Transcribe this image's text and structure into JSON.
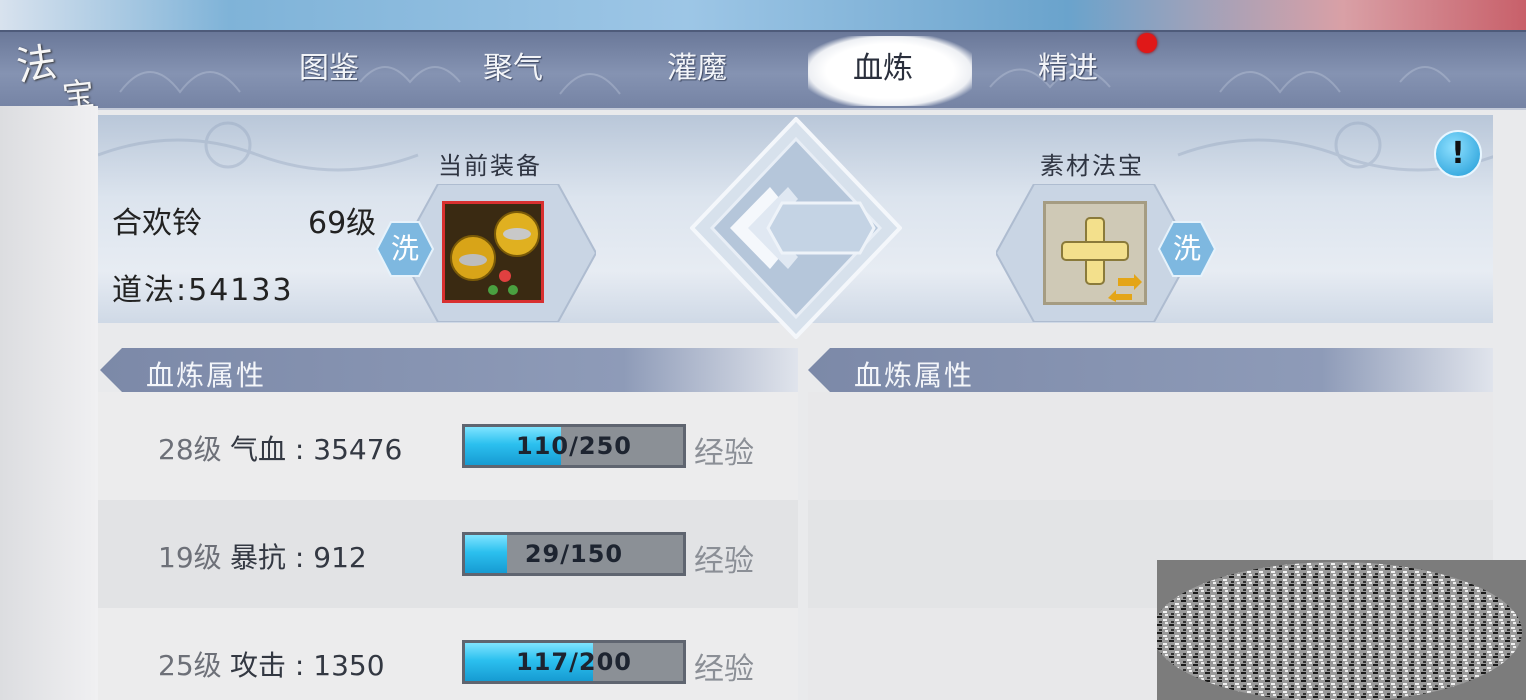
{
  "window": {
    "title_chars": [
      "法",
      "宝"
    ]
  },
  "tabs": [
    {
      "label": "图鉴",
      "active": false
    },
    {
      "label": "聚气",
      "active": false
    },
    {
      "label": "灌魔",
      "active": false
    },
    {
      "label": "血炼",
      "active": true
    },
    {
      "label": "精进",
      "active": false,
      "has_notification": true
    }
  ],
  "current_equipment": {
    "section_label": "当前装备",
    "name": "合欢铃",
    "level": "69级",
    "power": "道法:54133",
    "wash_label": "洗",
    "icon": "golden-bells-treasure-icon"
  },
  "material": {
    "section_label": "素材法宝",
    "wash_label": "洗",
    "icon": "add-plus-icon"
  },
  "left_attributes": {
    "header": "血炼属性",
    "rows": [
      {
        "level": "28级",
        "name": "气血",
        "value": "35476",
        "current": 110,
        "max": 250,
        "progress_text": "110/250",
        "exp_label": "经验"
      },
      {
        "level": "19级",
        "name": "暴抗",
        "value": "912",
        "current": 29,
        "max": 150,
        "progress_text": "29/150",
        "exp_label": "经验"
      },
      {
        "level": "25级",
        "name": "攻击",
        "value": "1350",
        "current": 117,
        "max": 200,
        "progress_text": "117/200",
        "exp_label": "经验"
      }
    ]
  },
  "right_attributes": {
    "header": "血炼属性"
  },
  "info_button": {
    "label": "!"
  },
  "colors": {
    "accent_blue": "#2cc0ef",
    "notify_red": "#e01818",
    "equip_border_red": "#d83030",
    "tab_bar": "#7b89a9"
  }
}
